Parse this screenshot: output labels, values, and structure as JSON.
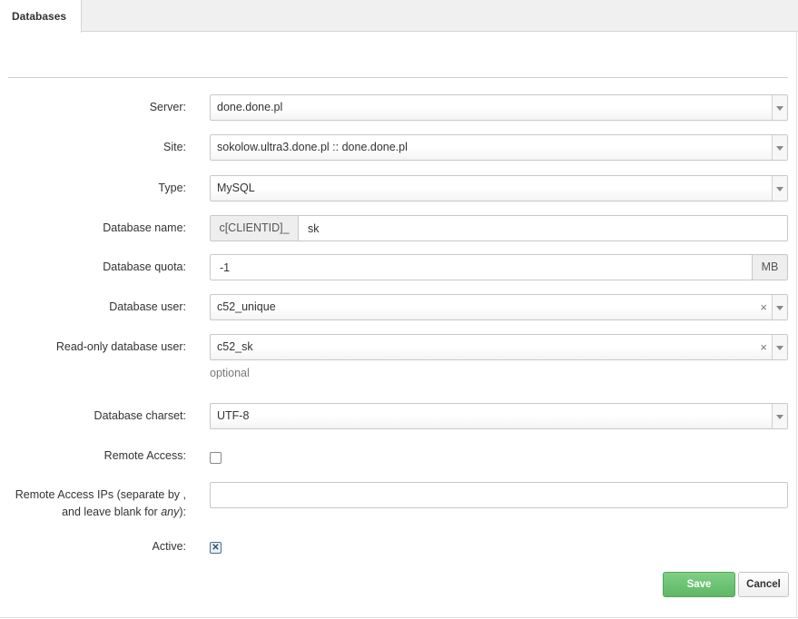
{
  "tabs": [
    {
      "label": "Databases",
      "active": true
    }
  ],
  "form": {
    "server": {
      "label": "Server:",
      "value": "done.done.pl"
    },
    "site": {
      "label": "Site:",
      "value": "sokolow.ultra3.done.pl :: done.done.pl"
    },
    "type": {
      "label": "Type:",
      "value": "MySQL"
    },
    "database_name": {
      "label": "Database name:",
      "prefix": "c[CLIENTID]_",
      "value": "sk"
    },
    "database_quota": {
      "label": "Database quota:",
      "value": "-1",
      "unit": "MB"
    },
    "database_user": {
      "label": "Database user:",
      "value": "c52_unique",
      "clear": "×"
    },
    "readonly_user": {
      "label": "Read-only database user:",
      "value": "c52_sk",
      "clear": "×",
      "help": "optional"
    },
    "charset": {
      "label": "Database charset:",
      "value": "UTF-8"
    },
    "remote_access": {
      "label": "Remote Access:",
      "checked": false
    },
    "remote_ips": {
      "label_line1": "Remote Access IPs (separate by ,",
      "label_line2_pre": "and leave blank for ",
      "label_line2_em": "any",
      "label_line2_post": "):",
      "value": ""
    },
    "active": {
      "label": "Active:",
      "checked": true,
      "mark": "✕"
    }
  },
  "buttons": {
    "save": "Save",
    "cancel": "Cancel"
  },
  "colors": {
    "save_bg": "#5eb865",
    "tab_bar_bg": "#f0f0f0"
  }
}
